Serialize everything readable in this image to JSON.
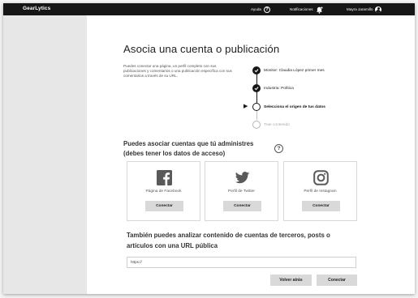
{
  "header": {
    "brand": "GearLytics",
    "help_label": "Ayuda",
    "help_icon": "?",
    "notifications_label": "Notificaciones",
    "user_name": "Mayra Jaramillo"
  },
  "main": {
    "title": "Asocia una cuenta o publicación",
    "intro": "Puedes conectar una página, un perfil completo con sus publicaciones y comentarios o una publicación específica con sus comentarios a través de su URL.",
    "steps": [
      {
        "label": "Monitor: Claudia López primer mes",
        "status": "done"
      },
      {
        "label": "Industria: Política",
        "status": "done"
      },
      {
        "label": "Selecciona el origen de tus datos",
        "status": "current"
      },
      {
        "label": "Trae contenido",
        "status": "pending"
      }
    ],
    "accounts_title": "Puedes asociar cuentas que tú administres (debes tener los datos de acceso)",
    "info_icon": "?",
    "cards": [
      {
        "icon": "facebook-icon",
        "label": "Página de Facebook",
        "button": "Conectar"
      },
      {
        "icon": "twitter-icon",
        "label": "Perfil de Twitter",
        "button": "Conectar"
      },
      {
        "icon": "instagram-icon",
        "label": "Perfil de Instagram",
        "button": "Conectar"
      }
    ],
    "third_party_title": "También puedes analizar contenido de cuentas de terceros, posts o artículos con una URL pública",
    "url_value": "https://",
    "back_button": "Volver atrás",
    "connect_button": "Conectar"
  },
  "colors": {
    "topbar": "#161616",
    "sidebar": "#e7e7e7",
    "button": "#d9d9d9",
    "pending": "#b5b5b5"
  }
}
